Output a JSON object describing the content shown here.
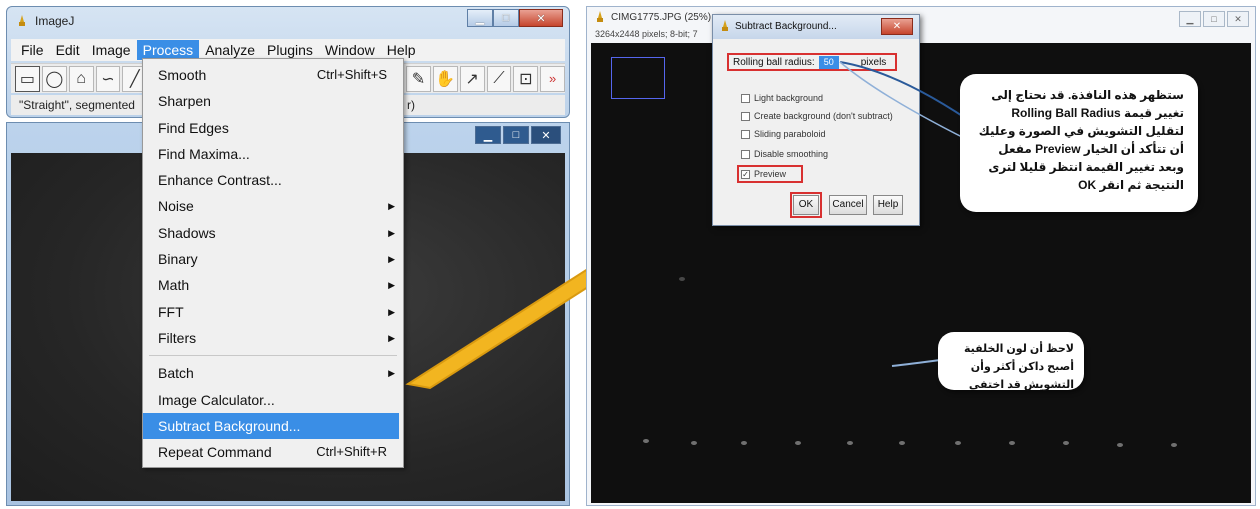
{
  "imagej": {
    "title": "ImageJ",
    "menus": [
      "File",
      "Edit",
      "Image",
      "Process",
      "Analyze",
      "Plugins",
      "Window",
      "Help"
    ],
    "active_menu": "Process",
    "status": "\"Straight\", segmented",
    "status_tail": "r)"
  },
  "process_menu": {
    "items": [
      {
        "label": "Smooth",
        "shortcut": "Ctrl+Shift+S",
        "submenu": false
      },
      {
        "label": "Sharpen",
        "shortcut": "",
        "submenu": false
      },
      {
        "label": "Find Edges",
        "shortcut": "",
        "submenu": false
      },
      {
        "label": "Find Maxima...",
        "shortcut": "",
        "submenu": false
      },
      {
        "label": "Enhance Contrast...",
        "shortcut": "",
        "submenu": false
      },
      {
        "label": "Noise",
        "shortcut": "",
        "submenu": true
      },
      {
        "label": "Shadows",
        "shortcut": "",
        "submenu": true
      },
      {
        "label": "Binary",
        "shortcut": "",
        "submenu": true
      },
      {
        "label": "Math",
        "shortcut": "",
        "submenu": true
      },
      {
        "label": "FFT",
        "shortcut": "",
        "submenu": true
      },
      {
        "label": "Filters",
        "shortcut": "",
        "submenu": true
      }
    ],
    "items2": [
      {
        "label": "Batch",
        "shortcut": "",
        "submenu": true
      },
      {
        "label": "Image Calculator...",
        "shortcut": "",
        "submenu": false
      },
      {
        "label": "Subtract Background...",
        "shortcut": "",
        "submenu": false,
        "highlighted": true
      },
      {
        "label": "Repeat Command",
        "shortcut": "Ctrl+Shift+R",
        "submenu": false
      }
    ]
  },
  "right_window": {
    "title": "CIMG1775.JPG (25%)",
    "subtitle": "3264x2448 pixels; 8-bit; 7"
  },
  "dialog": {
    "title": "Subtract Background...",
    "radius_label": "Rolling ball radius:",
    "radius_value": "50",
    "radius_unit": "pixels",
    "options": [
      {
        "label": "Light background",
        "checked": false
      },
      {
        "label": "Create background (don't subtract)",
        "checked": false
      },
      {
        "label": "Sliding paraboloid",
        "checked": false
      },
      {
        "label": "Disable smoothing",
        "checked": false
      },
      {
        "label": "Preview",
        "checked": true
      }
    ],
    "ok_label": "OK",
    "cancel_label": "Cancel",
    "help_label": "Help"
  },
  "callouts": {
    "main": "ستظهر هذه النافذة. قد نحتاج إلى تغيير قيمة Rolling Ball Radius لتقليل التشويش في الصورة وعليك أن تتأكد أن الخيار Preview مفعل وبعد تغيير القيمة انتظر قليلا لترى النتيجة ثم انقر OK",
    "note": "لاحظ أن لون الخلفية أصبح داكن أكثر وأن التشويش قد اختفى"
  },
  "colors": {
    "menu_highlight": "#3a8ee6",
    "arrow": "#f2b520",
    "annotation_red": "#d83030"
  }
}
